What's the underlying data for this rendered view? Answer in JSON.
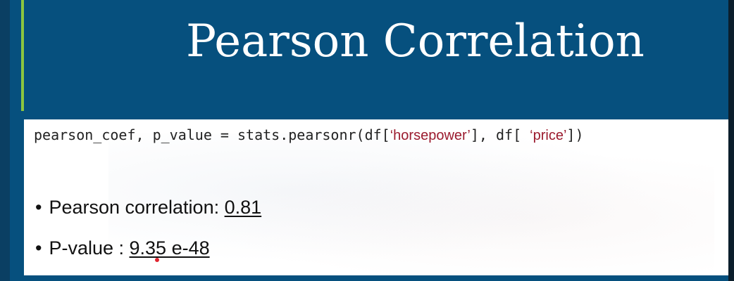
{
  "slide": {
    "title": "Pearson Correlation",
    "code": {
      "prefix": "pearson_coef, p_value = stats.pearsonr(df[",
      "arg1": "‘horsepower’",
      "middle": "], df[ ",
      "arg2": "‘price’",
      "suffix": "])"
    },
    "bullets": [
      {
        "marker": "•",
        "label": "Pearson correlation: ",
        "value": "0.81"
      },
      {
        "marker": "•",
        "label": "P-value : ",
        "value": "9.35 e-48"
      }
    ]
  },
  "colors": {
    "background": "#06507e",
    "accent": "#8cc63f",
    "string_literal": "#9b1b2e",
    "cursor": "#e0242f"
  }
}
